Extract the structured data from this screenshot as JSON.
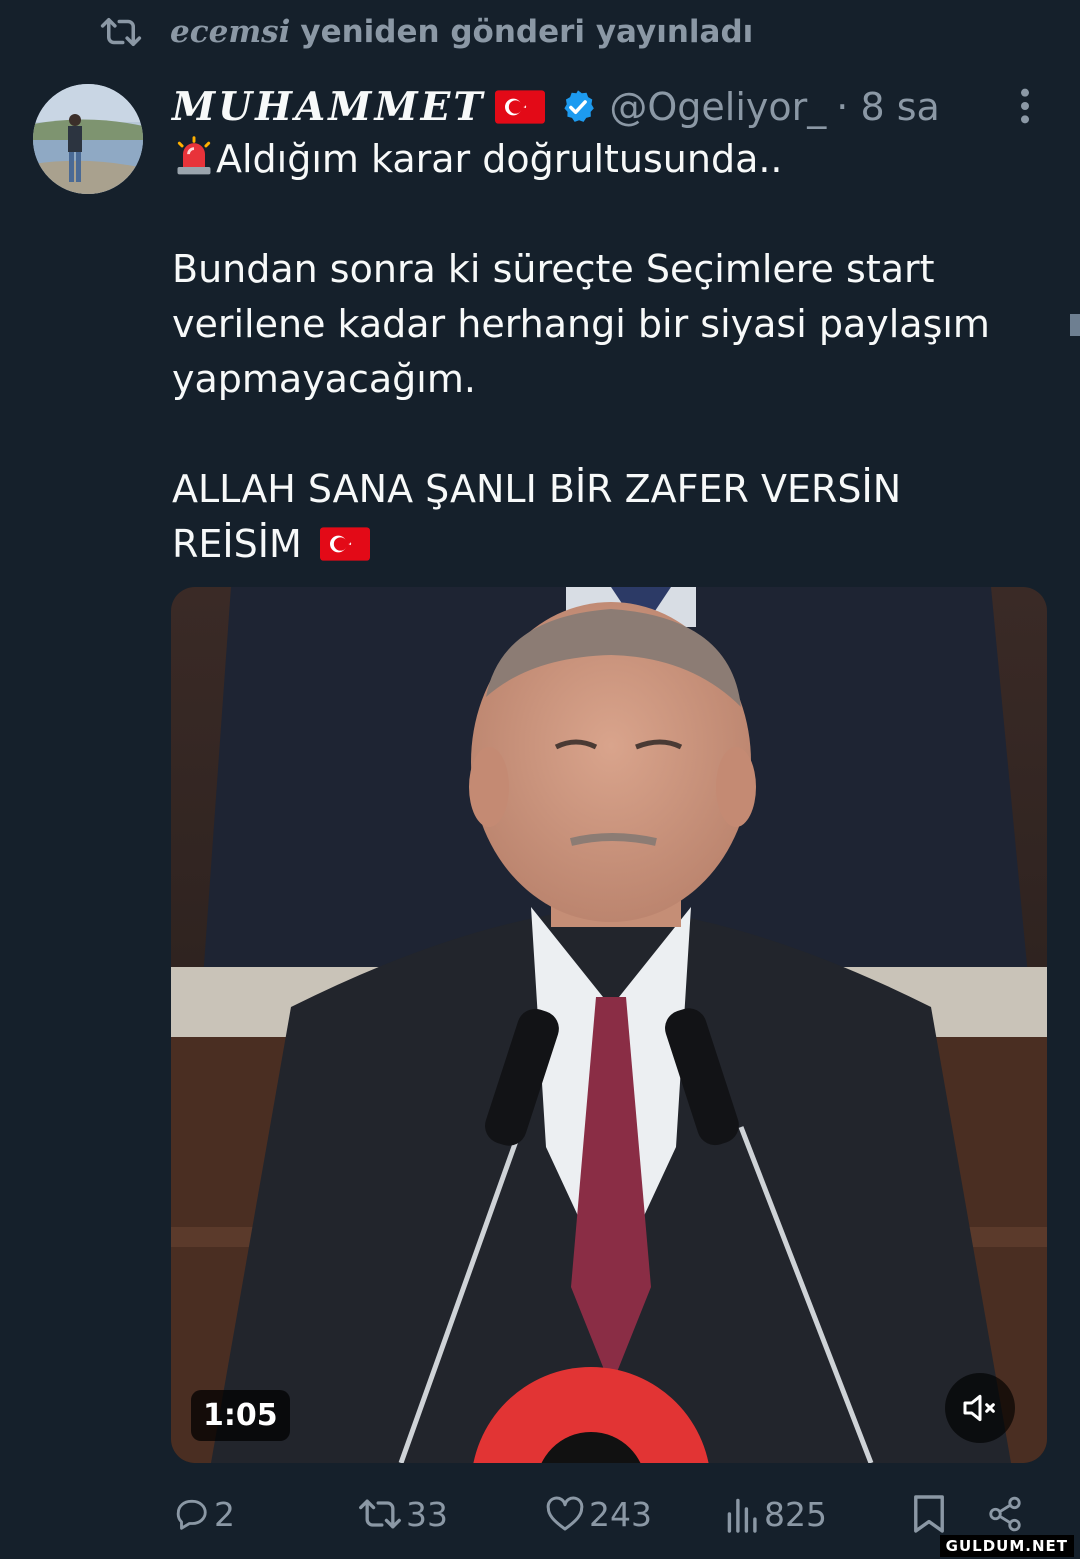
{
  "repost": {
    "user": "ecemsi",
    "text": "yeniden gönderi yayınladı"
  },
  "author": {
    "display_name": "MUHAMMET",
    "handle": "@Ogeliyor_",
    "time": "· 8 sa"
  },
  "tweet": {
    "line1": "Aldığım karar doğrultusunda..",
    "para2": "Bundan sonra ki süreçte Seçimlere start verilene kadar herhangi bir siyasi paylaşım yapmayacağım.",
    "para3": "ALLAH SANA ŞANLI BİR ZAFER VERSİN REİSİM"
  },
  "media": {
    "duration": "1:05",
    "muted": true
  },
  "actions": {
    "replies": "2",
    "reposts": "33",
    "likes": "243",
    "views": "825"
  },
  "watermark": "GULDUM.NET",
  "colors": {
    "background": "#15202b",
    "text": "#f7f9f9",
    "muted": "#8b98a5",
    "verified": "#1d9bf0",
    "flag_red": "#e30a17"
  },
  "icons": [
    "repost-icon",
    "verified-badge-icon",
    "more-options-icon",
    "siren-emoji",
    "turkey-flag",
    "mute-icon",
    "reply-icon",
    "like-icon",
    "views-icon",
    "bookmark-icon",
    "share-icon"
  ]
}
